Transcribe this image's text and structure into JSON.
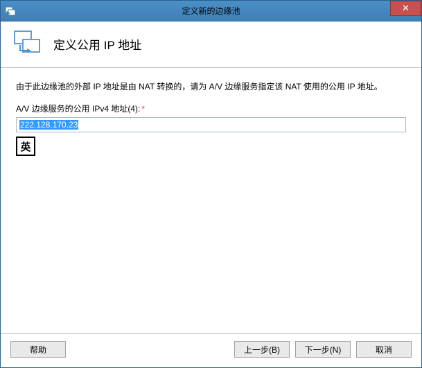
{
  "window": {
    "title": "定义新的边缘池"
  },
  "header": {
    "title": "定义公用 IP 地址"
  },
  "content": {
    "description": "由于此边缘池的外部 IP 地址是由 NAT 转换的，请为 A/V 边缘服务指定该 NAT 使用的公用 IP 地址。",
    "field_label": "A/V 边缘服务的公用 IPv4 地址(4):",
    "required_mark": "*",
    "ip_value": "222.128.170.23",
    "ime_badge": "英"
  },
  "buttons": {
    "help": "帮助",
    "back": "上一步(B)",
    "next": "下一步(N)",
    "cancel": "取消"
  },
  "icons": {
    "titlebar": "topology-icon",
    "header": "topology-wizard-icon",
    "close": "✕"
  }
}
